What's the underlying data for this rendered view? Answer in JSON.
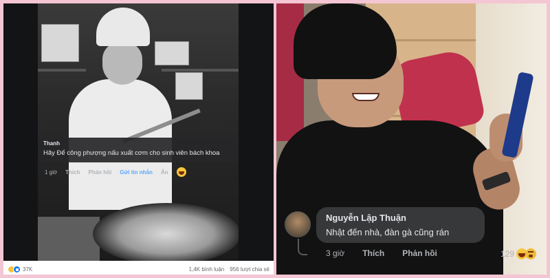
{
  "left_post": {
    "comment": {
      "author": "Thanh",
      "text": "Hãy Để công phượng nấu xuất cơm cho sinh viên bách khoa",
      "time": "1 giờ",
      "like_label": "Thích",
      "reply_label": "Phản hồi",
      "send_message_label": "Gửi tin nhắn",
      "hide_label": "Ẩn"
    },
    "footer": {
      "reaction_count": "37K",
      "comments": "1,4K bình luận",
      "shares": "956 lượt chia sẻ"
    }
  },
  "right_post": {
    "comment": {
      "author": "Nguyễn Lập Thuận",
      "text": "Nhật đến nhà, đàn gà cũng rán",
      "time": "3 giờ",
      "like_label": "Thích",
      "reply_label": "Phản hồi",
      "reaction_count": "129"
    }
  },
  "colors": {
    "frame_background": "#f4c6d3",
    "link_blue": "#5aa7ff",
    "reaction_like": "#1877f2",
    "reaction_haha": "#f7c53b"
  },
  "icons": [
    "haha-reaction-icon",
    "like-reaction-icon",
    "laugh-emoji-icon",
    "avatar"
  ]
}
